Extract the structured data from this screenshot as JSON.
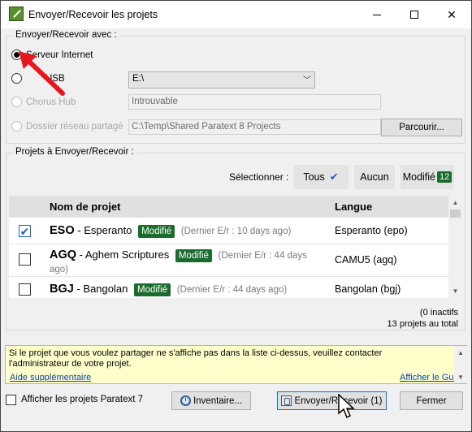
{
  "window": {
    "title": "Envoyer/Recevoir les projets"
  },
  "send_group": {
    "title": "Envoyer/Recevoir avec :",
    "options": {
      "internet": {
        "label": "Serveur Internet",
        "selected": true
      },
      "usb": {
        "label": "USB",
        "drive": "E:\\"
      },
      "chorus": {
        "label": "Chorus Hub",
        "value": "Introuvable"
      },
      "network": {
        "label": "Dossier réseau partagé",
        "value": "C:\\Temp\\Shared Paratext 8 Projects"
      }
    },
    "browse_label": "Parcourir..."
  },
  "projects_group": {
    "title": "Projets à Envoyer/Recevoir :",
    "select_label": "Sélectionner :",
    "select_all": "Tous",
    "select_none": "Aucun",
    "select_modified": "Modifié",
    "modified_count": "12",
    "columns": {
      "name": "Nom de projet",
      "language": "Langue"
    },
    "rows": [
      {
        "code": "ESO",
        "name": "Esperanto",
        "badge": "Modifié",
        "last": "(Dernier E/r : 10 days ago)",
        "language": "Esperanto (epo)",
        "checked": true
      },
      {
        "code": "AGQ",
        "name": "Aghem Scriptures",
        "badge": "Modifié",
        "last": "(Dernier E/r : 44 days ago)",
        "language": "CAMU5 (agq)",
        "checked": false
      },
      {
        "code": "BGJ",
        "name": "Bangolan",
        "badge": "Modifié",
        "last": "(Dernier E/r : 44 days ago)",
        "language": "Bangolan (bgj)",
        "checked": false
      }
    ],
    "inactive": "(0 inactifs",
    "total": "13 projets au total"
  },
  "info": {
    "message": "Si le projet que vous voulez partager ne s'affiche pas dans la liste ci-dessus, veuillez contacter l'administrateur de votre projet.",
    "help_link": "Aide supplémentaire",
    "guide_link": "Afficher le Guide"
  },
  "footer": {
    "show_pt7": "Afficher les projets Paratext 7",
    "inventory": "Inventaire...",
    "send_receive": "Envoyer/Recevoir (1)",
    "close": "Fermer"
  },
  "colors": {
    "modified_badge": "#1c6b2e",
    "info_background": "#ffffcc",
    "annotation_arrow": "#e8161c",
    "checkmark": "#2060c0"
  }
}
